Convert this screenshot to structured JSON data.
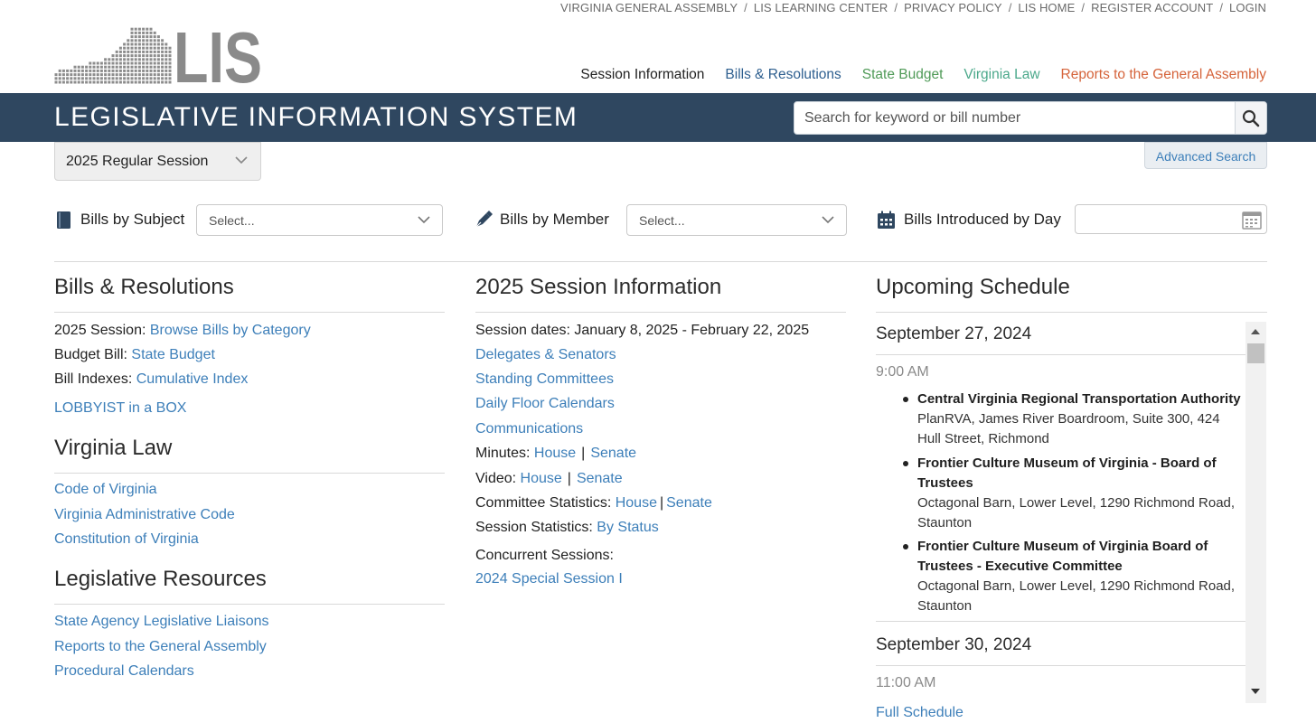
{
  "utility_nav": [
    "VIRGINIA GENERAL ASSEMBLY",
    "LIS LEARNING CENTER",
    "PRIVACY POLICY",
    "LIS HOME",
    "REGISTER ACCOUNT",
    "LOGIN"
  ],
  "logo_text": "LIS",
  "main_nav": [
    {
      "label": "Session Information",
      "color": "#222222"
    },
    {
      "label": "Bills & Resolutions",
      "color": "#2e5f8f"
    },
    {
      "label": "State Budget",
      "color": "#4f9a57"
    },
    {
      "label": "Virginia Law",
      "color": "#4aa88a"
    },
    {
      "label": "Reports to the General Assembly",
      "color": "#d5633a"
    }
  ],
  "banner_title": "LEGISLATIVE INFORMATION SYSTEM",
  "search": {
    "placeholder": "Search for keyword or bill number",
    "icon": "search-icon"
  },
  "session_select": "2025 Regular Session",
  "advanced_search": "Advanced Search",
  "filters": {
    "subject": {
      "label": "Bills by Subject",
      "placeholder": "Select..."
    },
    "member": {
      "label": "Bills by Member",
      "placeholder": "Select..."
    },
    "day": {
      "label": "Bills Introduced by Day"
    }
  },
  "bills": {
    "heading": "Bills & Resolutions",
    "session_label": "2025 Session:",
    "session_link": "Browse Bills by Category",
    "budget_label": "Budget Bill:",
    "budget_link": "State Budget",
    "index_label": "Bill Indexes:",
    "index_link": "Cumulative Index",
    "lobbyist": "LOBBYIST in a BOX"
  },
  "virginia_law": {
    "heading": "Virginia Law",
    "links": [
      "Code of Virginia",
      "Virginia Administrative Code",
      "Constitution of Virginia"
    ]
  },
  "resources": {
    "heading": "Legislative Resources",
    "links": [
      "State Agency Legislative Liaisons",
      "Reports to the General Assembly",
      "Procedural Calendars"
    ]
  },
  "session_info": {
    "heading": "2025 Session Information",
    "dates": "Session dates: January 8, 2025 - February 22, 2025",
    "links": [
      "Delegates & Senators",
      "Standing Committees",
      "Daily Floor Calendars",
      "Communications"
    ],
    "minutes_label": "Minutes:",
    "video_label": "Video:",
    "committee_stats_label": "Committee Statistics:",
    "session_stats_label": "Session Statistics:",
    "by_status": "By Status",
    "house": "House",
    "senate": "Senate",
    "concurrent_label": "Concurrent Sessions:",
    "concurrent_link": "2024 Special Session I"
  },
  "schedule": {
    "heading": "Upcoming Schedule",
    "day1": "September 27, 2024",
    "time1": "9:00 AM",
    "events": [
      {
        "name": "Central Virginia Regional Transportation Authority",
        "location": "PlanRVA, James River Boardroom, Suite 300, 424 Hull Street, Richmond"
      },
      {
        "name": "Frontier Culture Museum of Virginia - Board of Trustees",
        "location": "Octagonal Barn, Lower Level, 1290 Richmond Road, Staunton"
      },
      {
        "name": "Frontier Culture Museum of Virginia Board of Trustees - Executive Committee",
        "location": "Octagonal Barn, Lower Level, 1290 Richmond Road, Staunton"
      }
    ],
    "day2": "September 30, 2024",
    "time2": "11:00 AM",
    "full_link": "Full Schedule"
  }
}
